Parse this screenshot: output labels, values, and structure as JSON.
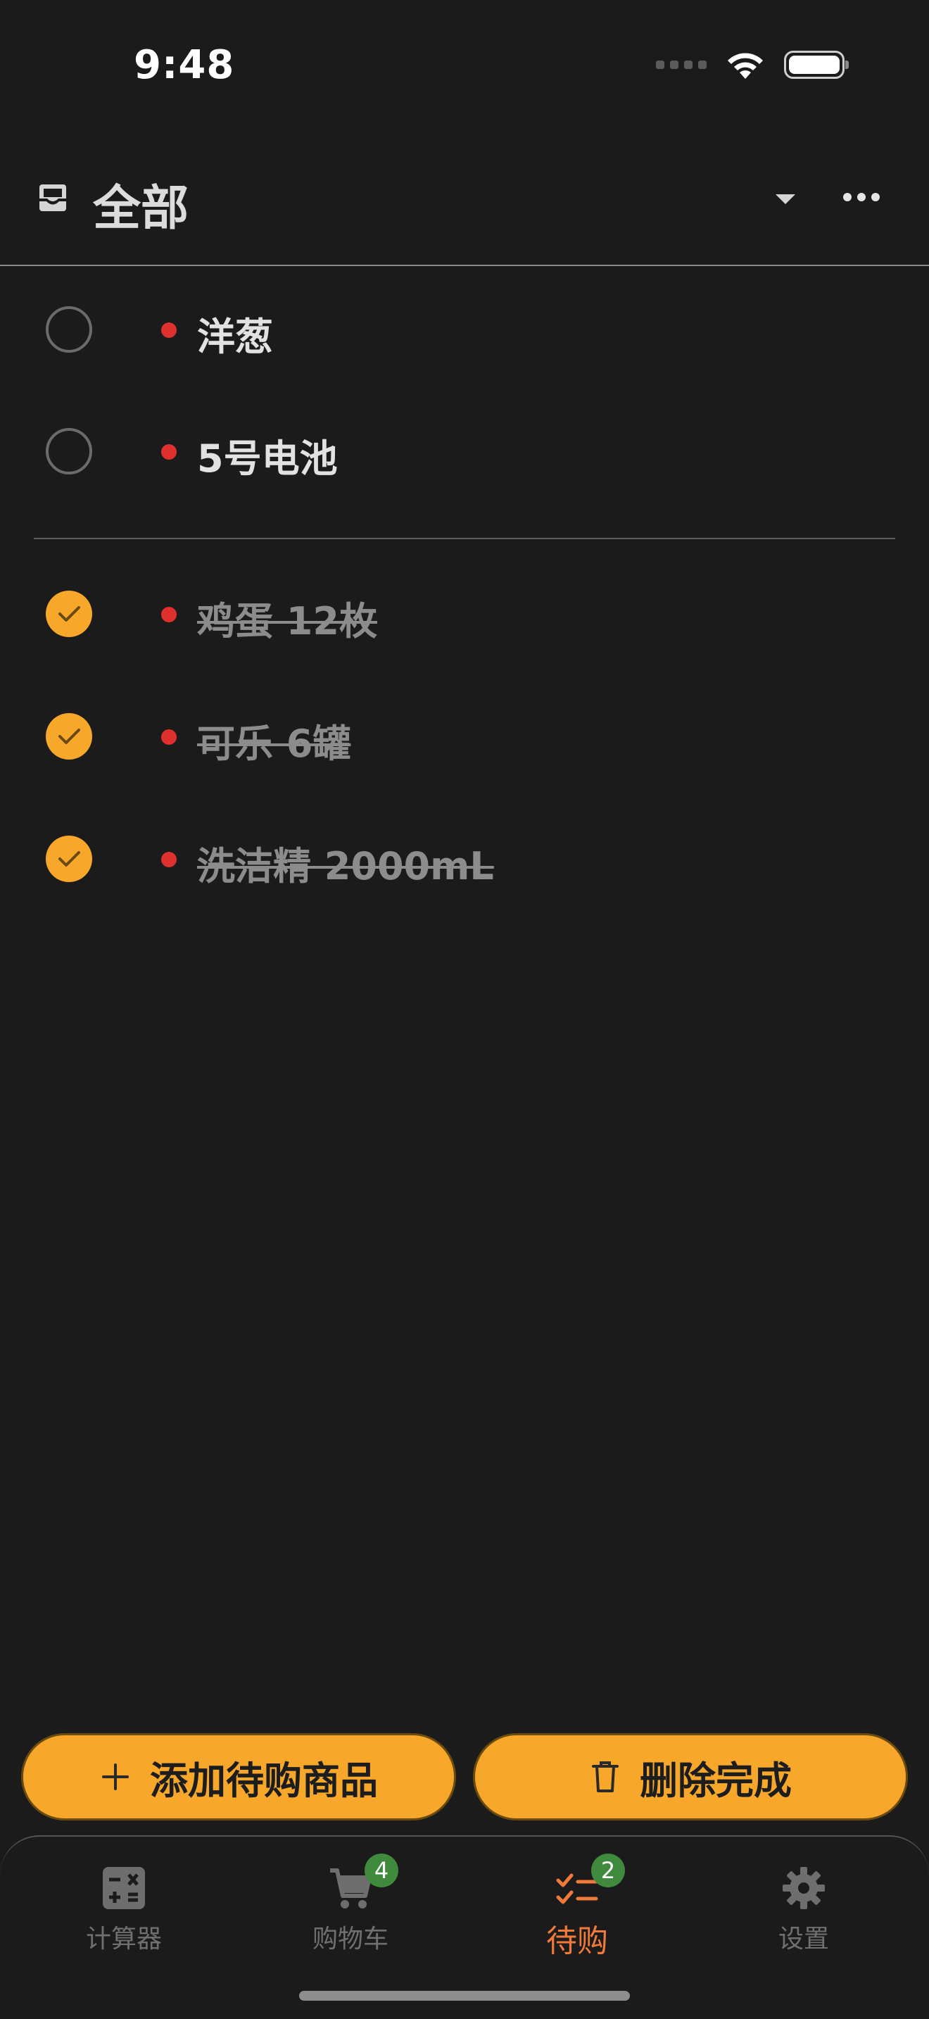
{
  "status_bar": {
    "time": "9:48"
  },
  "header": {
    "title": "全部",
    "icon": "inbox-icon"
  },
  "pending_items": [
    {
      "label": "洋葱",
      "checked": false
    },
    {
      "label": "5号电池",
      "checked": false
    }
  ],
  "completed_items": [
    {
      "label": "鸡蛋 12枚",
      "checked": true
    },
    {
      "label": "可乐 6罐",
      "checked": true
    },
    {
      "label": "洗洁精 2000mL",
      "checked": true
    }
  ],
  "actions": {
    "add_label": "添加待购商品",
    "delete_label": "删除完成"
  },
  "tabs": [
    {
      "label": "计算器",
      "icon": "calculator-icon",
      "active": false
    },
    {
      "label": "购物车",
      "icon": "cart-icon",
      "active": false,
      "badge": "4"
    },
    {
      "label": "待购",
      "icon": "checklist-icon",
      "active": true,
      "badge": "2"
    },
    {
      "label": "设置",
      "icon": "gear-icon",
      "active": false
    }
  ],
  "colors": {
    "background": "#1b1b1b",
    "accent": "#f7a72a",
    "active_tab": "#f07a3a",
    "priority_dot": "#e0302e",
    "badge": "#3f8a3c"
  }
}
